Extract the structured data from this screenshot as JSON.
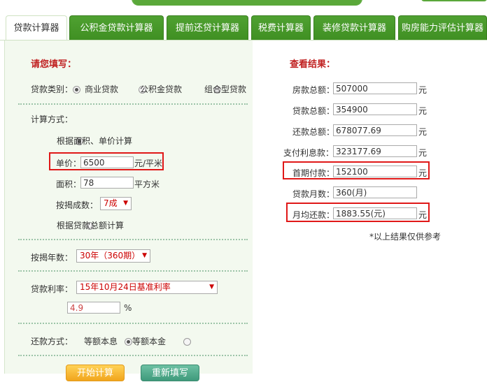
{
  "tabs": [
    {
      "label": "贷款计算器",
      "active": true
    },
    {
      "label": "公积金贷款计算器",
      "active": false
    },
    {
      "label": "提前还贷计算器",
      "active": false
    },
    {
      "label": "税费计算器",
      "active": false
    },
    {
      "label": "装修贷款计算器",
      "active": false
    },
    {
      "label": "购房能力评估计算器",
      "active": false
    }
  ],
  "form": {
    "title": "请您填写：",
    "loan_type_label": "贷款类别：",
    "loan_types": [
      "商业贷款",
      "公积金贷款",
      "组合型贷款"
    ],
    "loan_type_selected": "商业贷款",
    "calc_method_label": "计算方式：",
    "method_area_label": "根据面积、单价计算",
    "unit_price_label": "单价：",
    "unit_price_value": "6500",
    "unit_price_unit": "元/平米",
    "area_label": "面积：",
    "area_value": "78",
    "area_unit": "平方米",
    "mortgage_ratio_label": "按揭成数：",
    "mortgage_ratio_value": "7成",
    "method_total_label": "根据贷款总额计算",
    "years_label": "按揭年数：",
    "years_value": "30年（360期）",
    "rate_label": "贷款利率：",
    "rate_value": "15年10月24日基准利率",
    "rate_number": "4.9",
    "rate_unit": "%",
    "repay_label": "还款方式：",
    "repay_options": [
      "等额本息",
      "等额本金"
    ],
    "repay_selected": "等额本息",
    "calc_button": "开始计算",
    "reset_button": "重新填写"
  },
  "result": {
    "title": "查看结果：",
    "house_total_label": "房款总额：",
    "house_total_value": "507000",
    "loan_total_label": "贷款总额：",
    "loan_total_value": "354900",
    "repay_total_label": "还款总额：",
    "repay_total_value": "678077.69",
    "interest_label": "支付利息款：",
    "interest_value": "323177.69",
    "down_payment_label": "首期付款：",
    "down_payment_value": "152100",
    "months_label": "贷款月数：",
    "months_value": "360(月)",
    "monthly_label": "月均还款：",
    "monthly_value": "1883.55(元)",
    "unit_yuan": "元",
    "note": "*以上结果仅供参考"
  },
  "colors": {
    "tab_green": "#4fa131",
    "highlight_red": "#e01818",
    "title_red": "#c02020",
    "calc_button": "#f5b731",
    "reset_button": "#4fa888"
  }
}
